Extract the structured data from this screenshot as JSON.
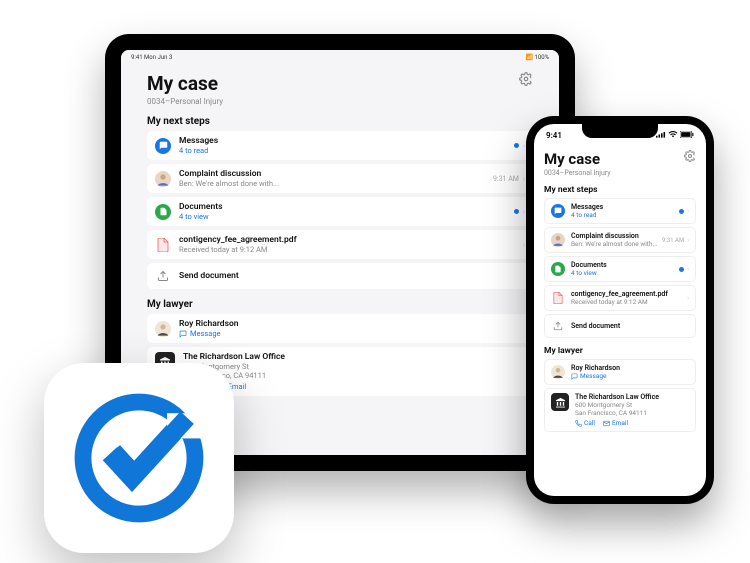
{
  "tablet": {
    "status": {
      "left": "9:41  Mon Jun 3",
      "right": "📶 100%"
    }
  },
  "phone": {
    "status": {
      "time": "9:41"
    }
  },
  "header": {
    "title": "My case",
    "subtitle": "0034–Personal Injury"
  },
  "next_steps": {
    "heading": "My next steps",
    "messages": {
      "title": "Messages",
      "subtitle": "4 to read"
    },
    "complaint": {
      "title": "Complaint discussion",
      "subtitle": "Ben: We're almost done with...",
      "time": "9:31 AM"
    },
    "documents": {
      "title": "Documents",
      "subtitle": "4 to view"
    },
    "pdf": {
      "title": "contigency_fee_agreement.pdf",
      "subtitle": "Received today at 9:12 AM"
    },
    "send": {
      "title": "Send document"
    }
  },
  "my_lawyer": {
    "heading": "My lawyer",
    "lawyer": {
      "name": "Roy Richardson",
      "action": "Message"
    },
    "office": {
      "name": "The Richardson Law Office",
      "addr1": "600 Montgomery St",
      "addr2": "San Francisco, CA 94111",
      "call": "Call",
      "email": "Email"
    }
  }
}
